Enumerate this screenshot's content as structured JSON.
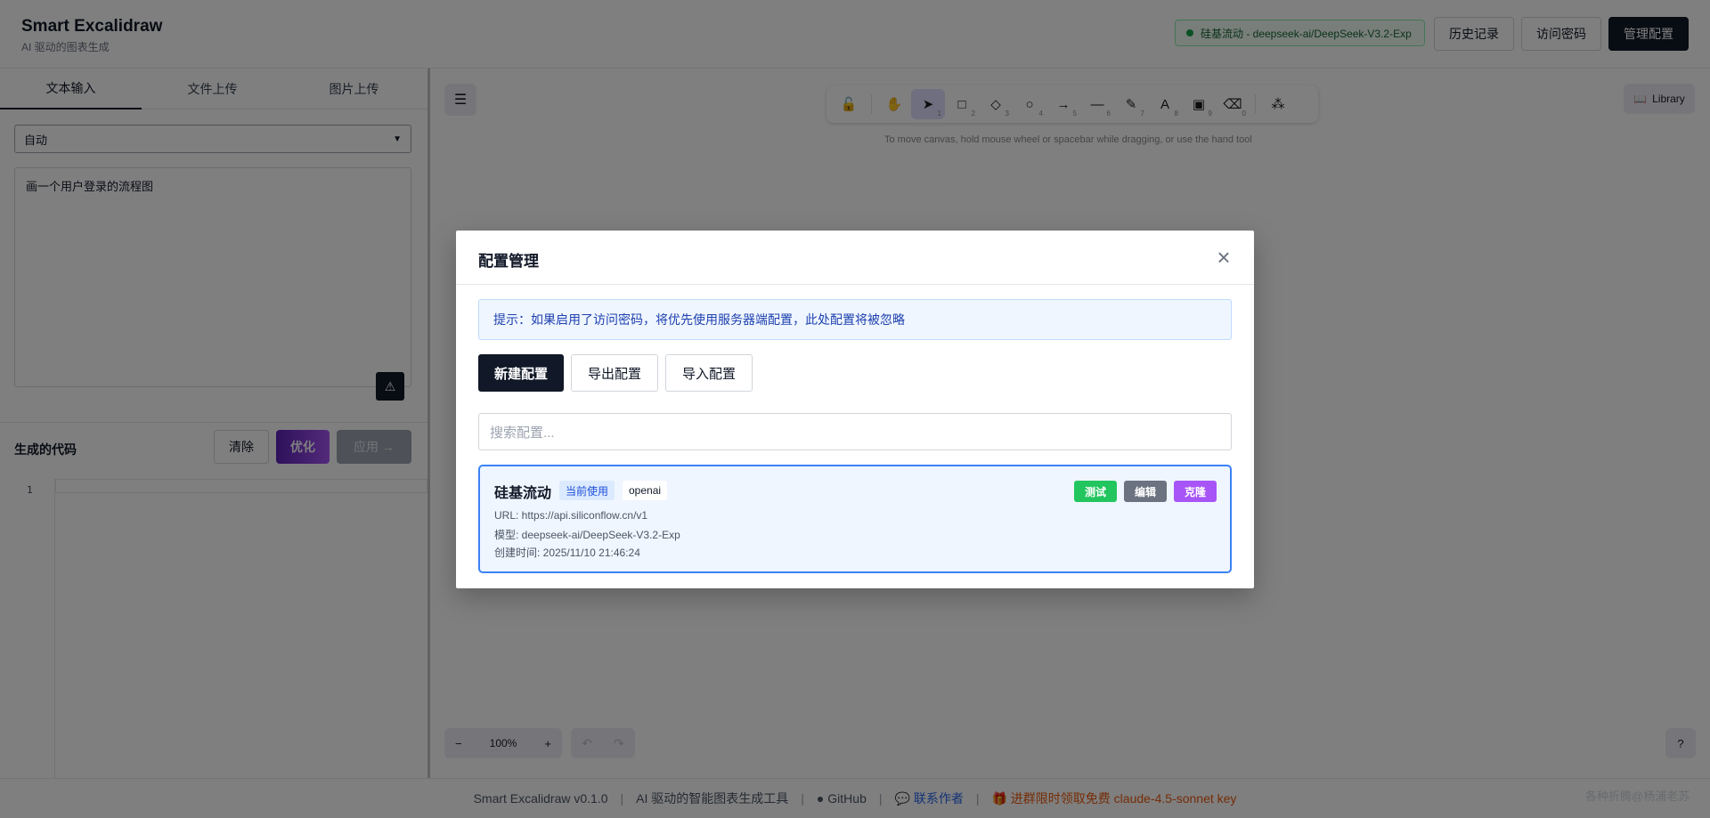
{
  "header": {
    "title": "Smart Excalidraw",
    "subtitle": "AI 驱动的图表生成",
    "model_status": "硅基流动 - deepseek-ai/DeepSeek-V3.2-Exp",
    "history_label": "历史记录",
    "access_password_label": "访问密码",
    "manage_config_label": "管理配置"
  },
  "left_panel": {
    "tabs": [
      {
        "label": "文本输入",
        "active": true
      },
      {
        "label": "文件上传",
        "active": false
      },
      {
        "label": "图片上传",
        "active": false
      }
    ],
    "chart_type_select": "自动",
    "prompt_text": "画一个用户登录的流程图",
    "code_title": "生成的代码",
    "clear_label": "清除",
    "optimize_label": "优化",
    "apply_label": "应用 →",
    "line_number": "1"
  },
  "canvas": {
    "tools": [
      {
        "icon": "lock-icon",
        "glyph": "🔓",
        "key": ""
      },
      {
        "icon": "hand-icon",
        "glyph": "✋",
        "key": ""
      },
      {
        "icon": "pointer-icon",
        "glyph": "➤",
        "key": "1"
      },
      {
        "icon": "rectangle-icon",
        "glyph": "□",
        "key": "2"
      },
      {
        "icon": "diamond-icon",
        "glyph": "◇",
        "key": "3"
      },
      {
        "icon": "ellipse-icon",
        "glyph": "○",
        "key": "4"
      },
      {
        "icon": "arrow-icon",
        "glyph": "→",
        "key": "5"
      },
      {
        "icon": "line-icon",
        "glyph": "—",
        "key": "6"
      },
      {
        "icon": "pencil-icon",
        "glyph": "✎",
        "key": "7"
      },
      {
        "icon": "text-icon",
        "glyph": "A",
        "key": "8"
      },
      {
        "icon": "image-icon",
        "glyph": "▣",
        "key": "9"
      },
      {
        "icon": "eraser-icon",
        "glyph": "⌫",
        "key": "0"
      },
      {
        "icon": "more-tools-icon",
        "glyph": "⁂",
        "key": ""
      }
    ],
    "hint": "To move canvas, hold mouse wheel or spacebar while dragging, or use the hand tool",
    "library_label": "Library",
    "zoom_level": "100%",
    "zoom_out": "−",
    "zoom_in": "+",
    "undo": "↶",
    "redo": "↷",
    "help": "?"
  },
  "footer": {
    "version": "Smart Excalidraw v0.1.0",
    "tagline": "AI 驱动的智能图表生成工具",
    "github": "GitHub",
    "contact": "联系作者",
    "promo": "进群限时领取免费 claude-4.5-sonnet key",
    "separator": "|",
    "watermark": "各种折腾@杨浦老苏"
  },
  "modal": {
    "title": "配置管理",
    "close": "×",
    "notice": "提示：如果启用了访问密码，将优先使用服务器端配置，此处配置将被忽略",
    "new_config_label": "新建配置",
    "export_config_label": "导出配置",
    "import_config_label": "导入配置",
    "search_placeholder": "搜索配置...",
    "configs": [
      {
        "name": "硅基流动",
        "current_badge": "当前使用",
        "type": "openai",
        "url": "URL: https://api.siliconflow.cn/v1",
        "model": "模型: deepseek-ai/DeepSeek-V3.2-Exp",
        "created": "创建时间: 2025/11/10 21:46:24",
        "test_label": "测试",
        "edit_label": "编辑",
        "clone_label": "克隆"
      }
    ]
  },
  "colors": {
    "primary_dark": "#111827",
    "accent_blue": "#3b82f6",
    "test_green": "#22c55e",
    "edit_gray": "#6b7280",
    "clone_purple": "#a855f7",
    "status_green": "#16a34a"
  }
}
